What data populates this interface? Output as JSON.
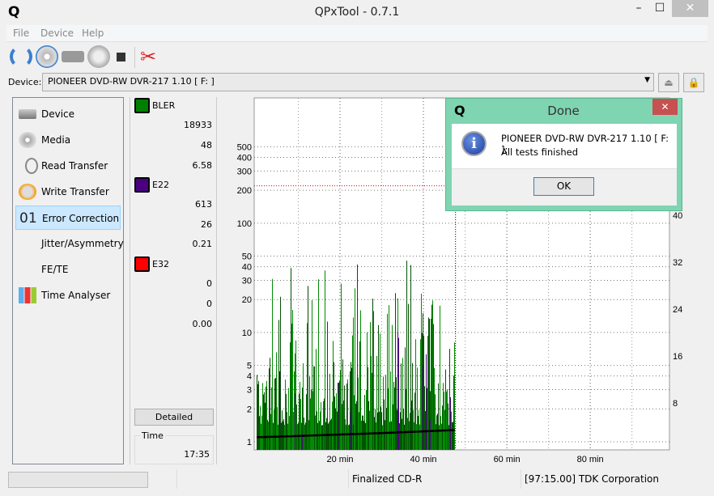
{
  "window": {
    "title": "QPxTool - 0.7.1",
    "minimize": "–",
    "maximize": "☐",
    "close": "✕"
  },
  "menu": [
    {
      "label": "File"
    },
    {
      "label": "Device"
    },
    {
      "label": "Help"
    }
  ],
  "toolbar": [
    "refresh-icon",
    "media-refresh-icon",
    "device-icon",
    "scan-icon",
    "stop-icon",
    "settings-icon"
  ],
  "device": {
    "label": "Device:",
    "value": "PIONEER  DVD-RW  DVR-217  1.10 [ F: ]"
  },
  "nav": [
    {
      "label": "Device",
      "icon": "drive-icon"
    },
    {
      "label": "Media",
      "icon": "disc-icon"
    },
    {
      "label": "Read Transfer",
      "icon": "stopwatch-icon"
    },
    {
      "label": "Write Transfer",
      "icon": "fire-stopwatch-icon"
    },
    {
      "label": "Error Correction",
      "icon": "01",
      "selected": true
    },
    {
      "label": "Jitter/Asymmetry"
    },
    {
      "label": "FE/TE"
    },
    {
      "label": "Time Analyser",
      "icon": "bars-icon"
    }
  ],
  "stats": {
    "bler": {
      "label": "BLER",
      "color": "#008000",
      "total": "18933",
      "max": "48",
      "avg": "6.58"
    },
    "e22": {
      "label": "E22",
      "color": "#4b0082",
      "total": "613",
      "max": "26",
      "avg": "0.21"
    },
    "e32": {
      "label": "E32",
      "color": "#ff0000",
      "total": "0",
      "max": "0",
      "avg": "0.00"
    },
    "detailed": "Detailed",
    "time_label": "Time",
    "time": "17:35"
  },
  "chart_data": {
    "type": "bar",
    "x_unit": "min",
    "xlim": [
      0,
      99
    ],
    "x_ticks": [
      "20 min",
      "40 min",
      "60 min",
      "80 min"
    ],
    "y_scale": "log",
    "ylim": [
      1,
      1400
    ],
    "y_ticks": [
      "1",
      "2",
      "3",
      "4",
      "5",
      "10",
      "20",
      "30",
      "40",
      "50",
      "100",
      "200",
      "300",
      "400",
      "500"
    ],
    "y2_ticks": [
      "8",
      "16",
      "24",
      "32",
      "40"
    ],
    "threshold": 220,
    "data_end_min": 47.5,
    "grid": true,
    "series": [
      {
        "name": "BLER",
        "color": "#008000",
        "max": 48,
        "avg": 6.58
      },
      {
        "name": "E22",
        "color": "#4b0082",
        "max": 26,
        "avg": 0.21
      },
      {
        "name": "E32",
        "color": "#ff0000",
        "max": 0
      }
    ]
  },
  "status": {
    "media": "Finalized CD-R",
    "manufacturer": "[97:15.00] TDK Corporation"
  },
  "dialog": {
    "title": "Done",
    "line1": "PIONEER  DVD-RW  DVR-217  1.10 [ F: ]:",
    "line2": "All tests finished",
    "ok": "OK",
    "close": "✕"
  }
}
